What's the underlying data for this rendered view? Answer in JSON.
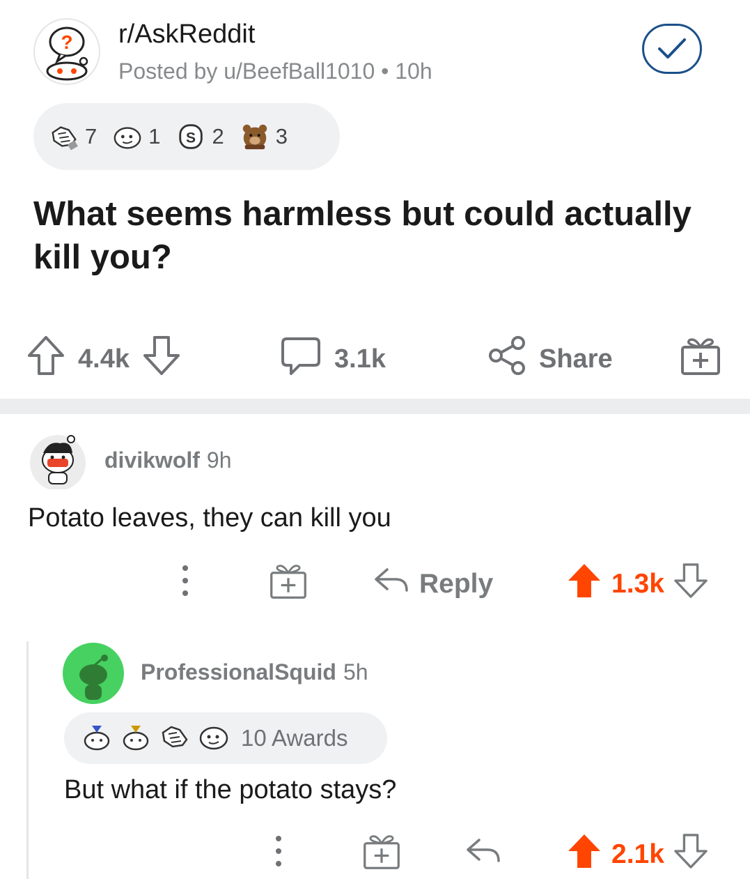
{
  "post": {
    "subreddit": "r/AskReddit",
    "posted_by": "Posted by u/BeefBall1010 • 10h",
    "awards": [
      {
        "icon": "handshake-icon",
        "count": "7"
      },
      {
        "icon": "snoo-face-icon",
        "count": "1"
      },
      {
        "icon": "silver-coin-icon",
        "count": "2"
      },
      {
        "icon": "bear-icon",
        "count": "3"
      }
    ],
    "title": "What seems harmless but could actually kill you?",
    "score": "4.4k",
    "comments": "3.1k",
    "share_label": "Share"
  },
  "comments": [
    {
      "user": "divikwolf",
      "time": "9h",
      "body": "Potato leaves, they can kill you",
      "reply_label": "Reply",
      "score": "1.3k"
    },
    {
      "user": "ProfessionalSquid",
      "time": "5h",
      "awards_label": "10 Awards",
      "award_icons": [
        "party-snoo-icon",
        "party-snoo-icon",
        "handshake-icon",
        "snoo-face-icon"
      ],
      "body": "But what if the potato stays?",
      "score": "2.1k"
    }
  ],
  "colors": {
    "upvote": "#ff4500",
    "muted": "#787c7e",
    "join_border": "#1a4f8a",
    "avatar_green": "#46d160"
  }
}
